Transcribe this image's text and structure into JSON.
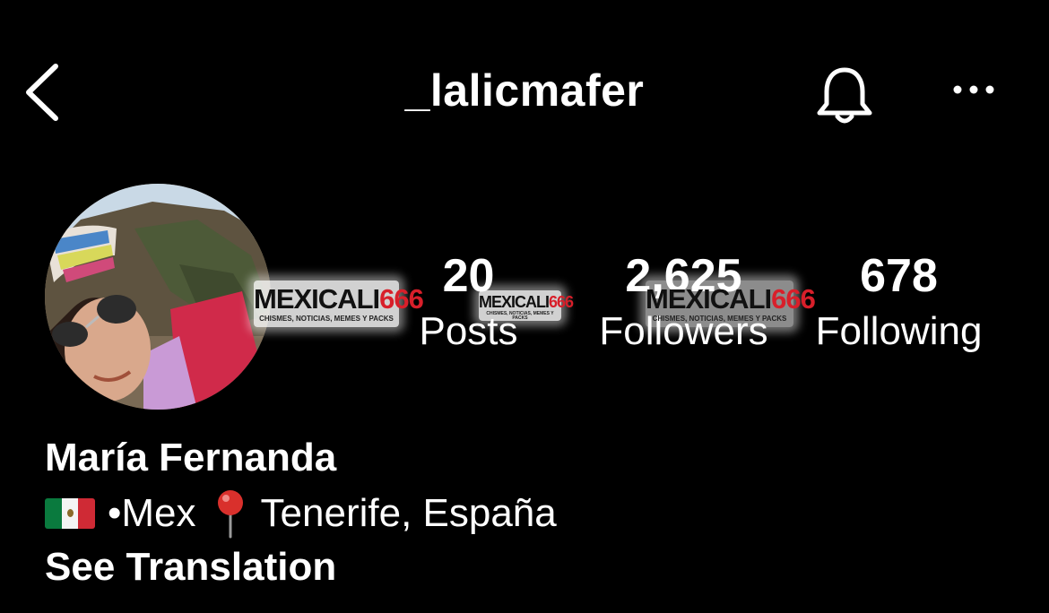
{
  "header": {
    "username": "_lalicmafer",
    "back_icon": "chevron-left-icon",
    "bell_icon": "bell-icon",
    "more_icon": "ellipsis-icon"
  },
  "stats": {
    "posts": {
      "value": "20",
      "label": "Posts"
    },
    "followers": {
      "value": "2,625",
      "label": "Followers"
    },
    "following": {
      "value": "678",
      "label": "Following"
    }
  },
  "profile": {
    "display_name": "María Fernanda",
    "bio_country": "•Mex",
    "bio_location": "Tenerife, España",
    "see_translation": "See Translation"
  },
  "watermark": {
    "brand": "MEXICALI",
    "brand_number": "666",
    "tagline": "CHISMES, NOTICIAS, MEMES Y PACKS"
  },
  "colors": {
    "background": "#000000",
    "text": "#ffffff",
    "watermark_red": "#d81f2a"
  }
}
